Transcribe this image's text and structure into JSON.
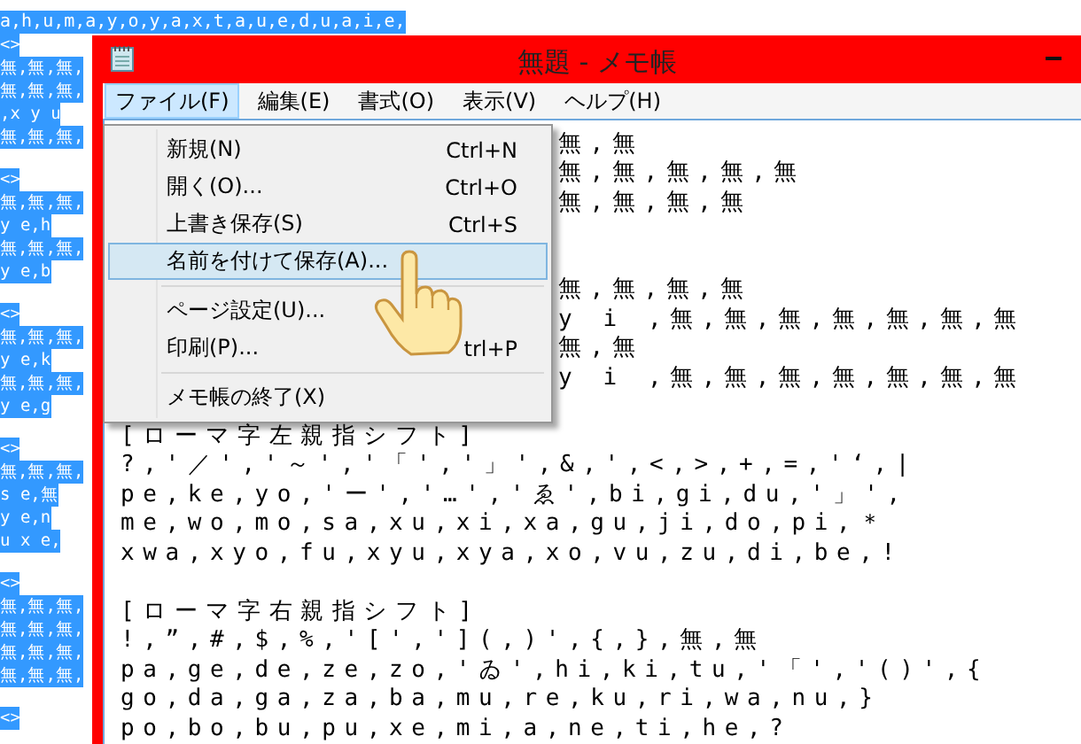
{
  "background_editor": {
    "top_line": "a,h,u,m,a,y,o,y,a,x,t,a,u,e,d,u,a,i,e,",
    "blocks": [
      [
        "<>",
        "無,無,無,",
        "無,無,無,",
        ",x y u",
        "無,無,無,"
      ],
      [
        "<>",
        "無,無,無,",
        "y e,h",
        "無,無,無,",
        "y e,b"
      ],
      [
        "<>",
        "無,無,無,",
        "y e,k",
        "無,無,無,",
        "y e,g"
      ],
      [
        "<>",
        "無,無,無,",
        "s e,無",
        "y e,n",
        "u x e,"
      ],
      [
        "<>",
        "無,無,無,",
        "無,無,無,",
        "無,無,無,",
        "無,無,無,"
      ],
      [
        "<>"
      ]
    ]
  },
  "window": {
    "title": "無題 - メモ帳"
  },
  "menu_bar": [
    {
      "label": "ファイル(F)",
      "selected": true
    },
    {
      "label": "編集(E)",
      "selected": false
    },
    {
      "label": "書式(O)",
      "selected": false
    },
    {
      "label": "表示(V)",
      "selected": false
    },
    {
      "label": "ヘルプ(H)",
      "selected": false
    }
  ],
  "file_menu": [
    {
      "kind": "item",
      "label": "新規(N)",
      "shortcut": "Ctrl+N",
      "selected": false
    },
    {
      "kind": "item",
      "label": "開く(O)...",
      "shortcut": "Ctrl+O",
      "selected": false
    },
    {
      "kind": "item",
      "label": "上書き保存(S)",
      "shortcut": "Ctrl+S",
      "selected": false
    },
    {
      "kind": "item",
      "label": "名前を付けて保存(A)...",
      "selected": true
    },
    {
      "kind": "separator"
    },
    {
      "kind": "item",
      "label": "ページ設定(U)...",
      "selected": false
    },
    {
      "kind": "item",
      "label": "印刷(P)...",
      "shortcut": "trl+P",
      "selected": false
    },
    {
      "kind": "separator"
    },
    {
      "kind": "item",
      "label": "メモ帳の終了(X)",
      "selected": false
    }
  ],
  "editor_lines": [
    {
      "kind": "beside",
      "text": "無,無"
    },
    {
      "kind": "beside",
      "text": "無,無,無,無,無"
    },
    {
      "kind": "beside",
      "text": "無,無,無,無"
    },
    {
      "kind": "beside"
    },
    {
      "kind": "beside"
    },
    {
      "kind": "beside",
      "text": "無,無,無,無"
    },
    {
      "kind": "beside",
      "text": "y i ,無,無,無,無,無,無,無"
    },
    {
      "kind": "beside",
      "text": "無,無"
    },
    {
      "kind": "beside",
      "text": "y i ,無,無,無,無,無,無,無"
    },
    {
      "kind": "beside"
    },
    {
      "kind": "full",
      "text": "[ローマ字左親指シフト]"
    },
    {
      "kind": "full",
      "text": "?,'／','～','「','」',&,',<,>,+,=,'‘,|"
    },
    {
      "kind": "full",
      "text": "pe,ke,yo,'ー','…','ゑ',bi,gi,du,'」',"
    },
    {
      "kind": "full",
      "text": "me,wo,mo,sa,xu,xi,xa,gu,ji,do,pi,＊"
    },
    {
      "kind": "full",
      "text": "xwa,xyo,fu,xyu,xya,xo,vu,zu,di,be,!"
    },
    {
      "kind": "full"
    },
    {
      "kind": "full",
      "text": "[ローマ字右親指シフト]"
    },
    {
      "kind": "full",
      "text": "!,”,#,$,%,'[','](,)',{,},無,無"
    },
    {
      "kind": "full",
      "text": "pa,ge,de,ze,zo,'ゐ',hi,ki,tu,'「','()',{"
    },
    {
      "kind": "full",
      "text": "go,da,ga,za,ba,mu,re,ku,ri,wa,nu,}"
    },
    {
      "kind": "full",
      "text": "po,bo,bu,pu,xe,mi,a,ne,ti,he,?"
    }
  ]
}
